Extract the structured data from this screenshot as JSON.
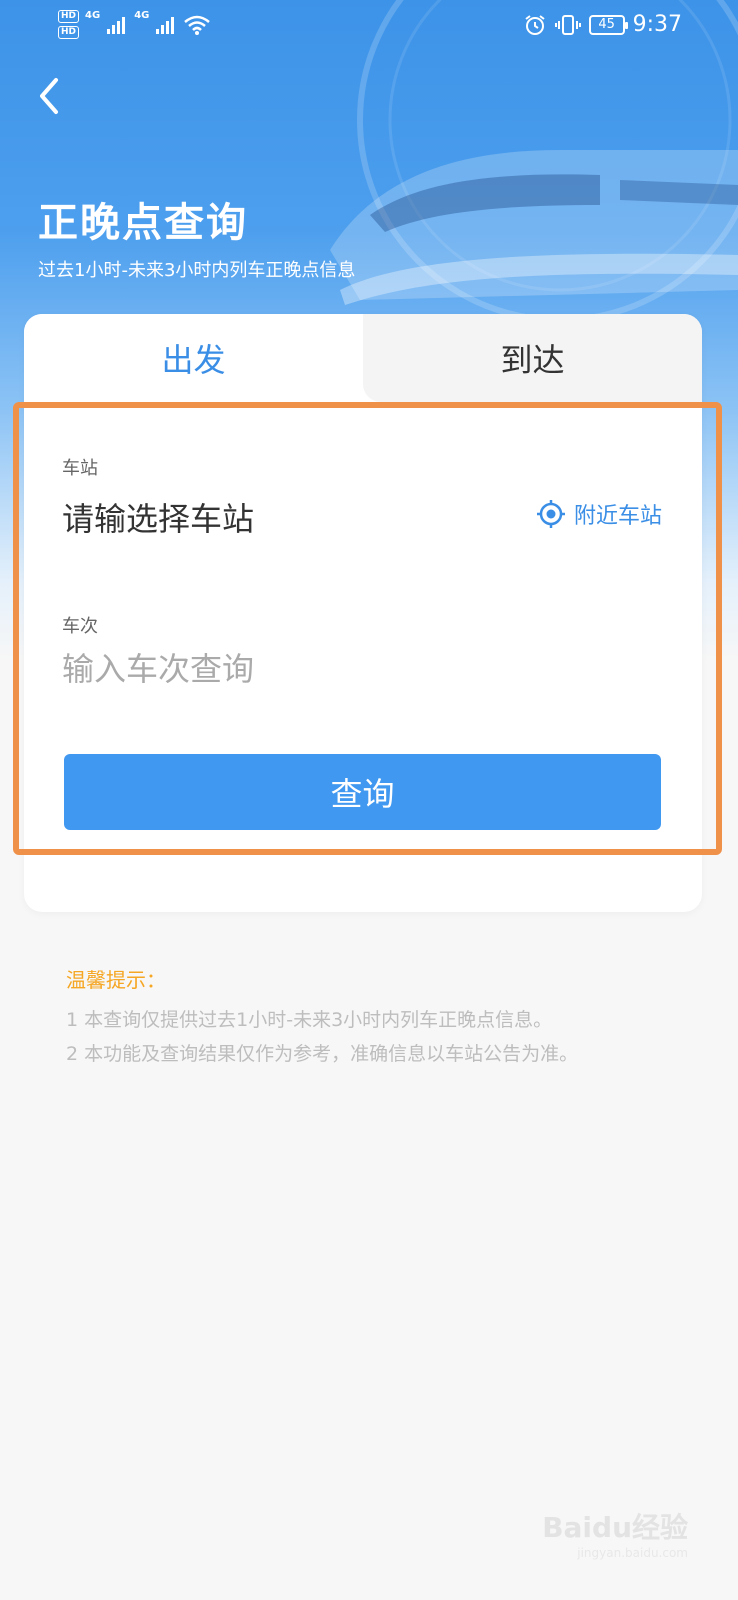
{
  "status_bar": {
    "hd1": "HD",
    "hd2": "HD",
    "net1": "4G",
    "net2": "4G",
    "battery": "45",
    "time": "9:37"
  },
  "header": {
    "title": "正晚点查询",
    "subtitle": "过去1小时-未来3小时内列车正晚点信息"
  },
  "tabs": [
    {
      "label": "出发",
      "active": true
    },
    {
      "label": "到达",
      "active": false
    }
  ],
  "form": {
    "station_label": "车站",
    "station_value": "请输选择车站",
    "nearby_label": "附近车站",
    "train_label": "车次",
    "train_placeholder": "输入车次查询",
    "query_button": "查询"
  },
  "tips": {
    "title": "温馨提示：",
    "lines": [
      "1 本查询仅提供过去1小时-未来3小时内列车正晚点信息。",
      "2 本功能及查询结果仅作为参考，准确信息以车站公告为准。"
    ]
  },
  "watermark": {
    "brand": "Baidu经验",
    "url": "jingyan.baidu.com"
  },
  "colors": {
    "accent": "#3a8ee6",
    "button": "#4198f0",
    "highlight": "#f0914a",
    "tips_title": "#f5a623"
  }
}
